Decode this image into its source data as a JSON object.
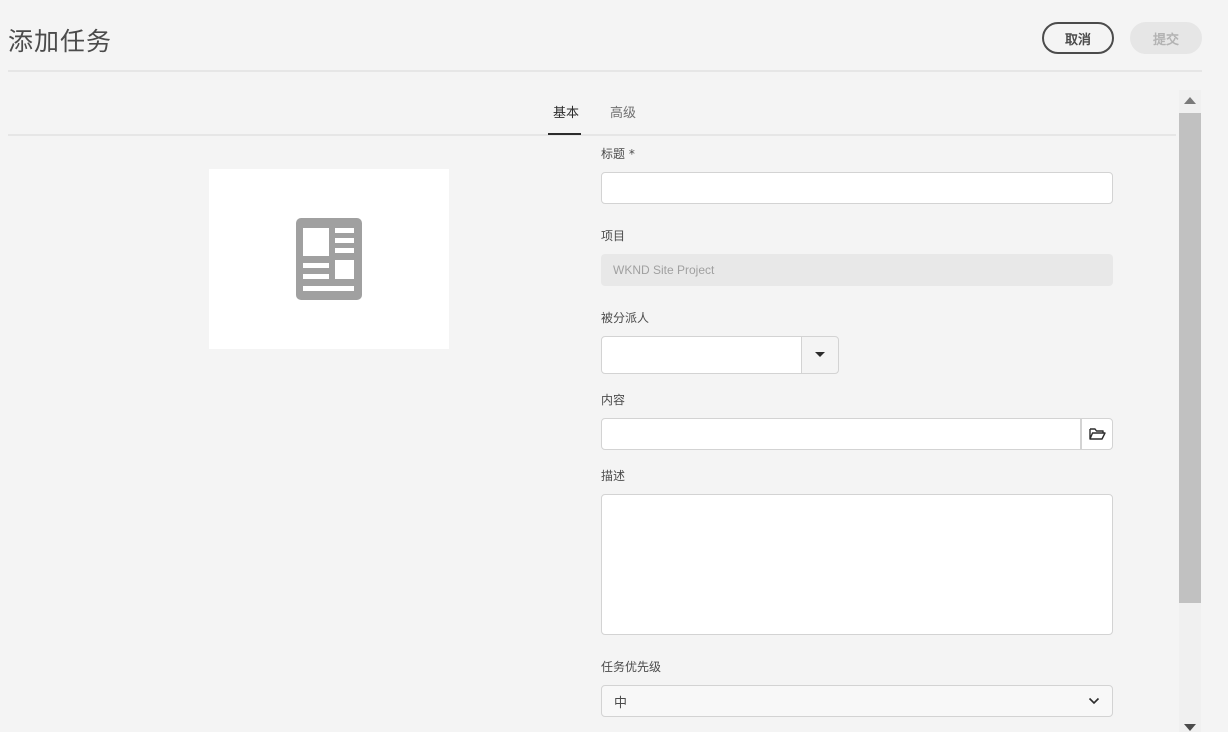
{
  "header": {
    "title": "添加任务",
    "cancel_label": "取消",
    "submit_label": "提交"
  },
  "tabs": [
    {
      "label": "基本",
      "active": true
    },
    {
      "label": "高级",
      "active": false
    }
  ],
  "thumbnail": {
    "icon": "document-layout-icon"
  },
  "form": {
    "title_label": "标题 *",
    "title_value": "",
    "project_label": "项目",
    "project_value": "WKND Site Project",
    "assignee_label": "被分派人",
    "assignee_value": "",
    "content_label": "内容",
    "content_value": "",
    "description_label": "描述",
    "description_value": "",
    "priority_label": "任务优先级",
    "priority_value": "中"
  },
  "colors": {
    "background": "#f4f4f4",
    "text": "#4b4b4b",
    "disabled": "#e6e6e6",
    "scroll_thumb": "#c1c1c1"
  }
}
